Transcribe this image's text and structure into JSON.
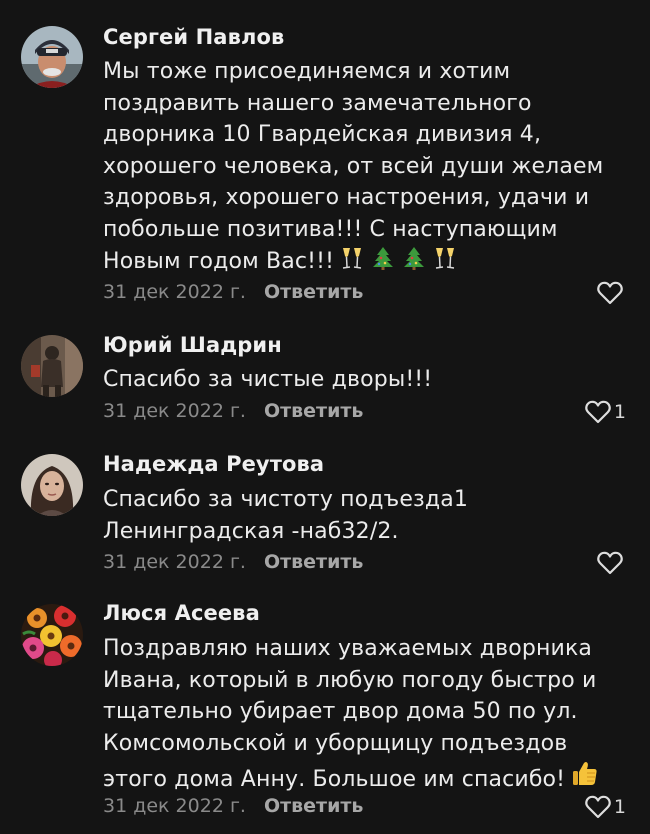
{
  "comments": [
    {
      "author": "Сергей Павлов",
      "text_lines": [
        "Мы тоже присоединяемся и хотим",
        "поздравить нашего замечательного",
        "дворника 10 Гвардейская дивизия 4,",
        "хорошего человека, от всей души желаем",
        "здоровья, хорошего настроения, удачи и",
        "побольше позитива!!! С наступающим",
        "Новым годом Вас!!!"
      ],
      "emojis": [
        "champagne-glasses-icon",
        "christmas-tree-icon",
        "christmas-tree-icon",
        "champagne-glasses-icon"
      ],
      "date": "31 дек 2022 г.",
      "reply": "Ответить",
      "likes": ""
    },
    {
      "author": "Юрий Шадрин",
      "text_lines": [
        "Спасибо за чистые дворы!!!"
      ],
      "date": "31 дек 2022 г.",
      "reply": "Ответить",
      "likes": "1"
    },
    {
      "author": "Надежда Реутова",
      "text_lines": [
        "Спасибо за чистоту подъезда1",
        "Ленинградская -наб32/2."
      ],
      "date": "31 дек 2022 г.",
      "reply": "Ответить",
      "likes": ""
    },
    {
      "author": "Люся Асеева",
      "text_lines": [
        "Поздравляю наших уважаемых дворника",
        "Ивана, который в любую погоду быстро и",
        "тщательно убирает двор дома 50 по ул.",
        "Комсомольской и уборщицу  подъездов",
        "этого дома  Анну. Большое им спасибо!"
      ],
      "emojis": [
        "thumbs-up-icon"
      ],
      "date": "31 дек 2022 г.",
      "reply": "Ответить",
      "likes": "1"
    }
  ],
  "colors": {
    "background": "#141414",
    "text": "#ececec",
    "date": "#8a8a8a",
    "reply": "#a7a7a7"
  }
}
